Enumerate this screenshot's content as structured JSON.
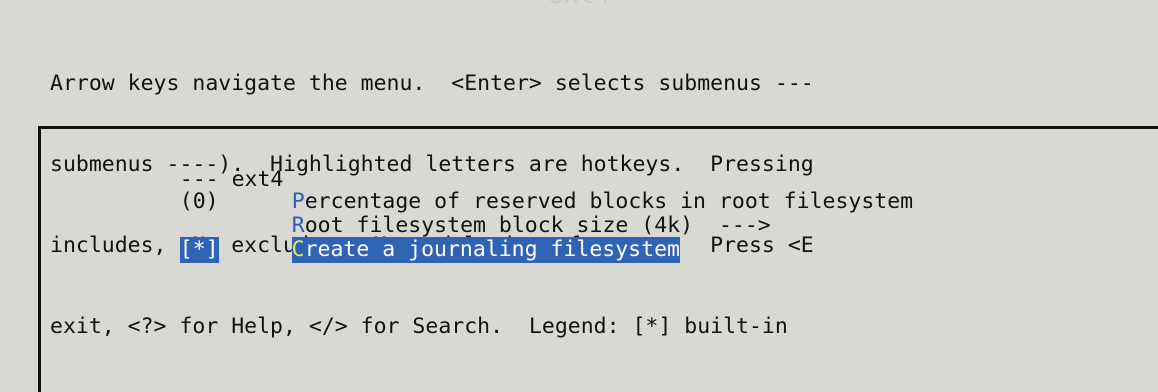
{
  "title_fragment": "ext4",
  "help_lines": [
    "Arrow keys navigate the menu.  <Enter> selects submenus ---",
    "submenus ----).  Highlighted letters are hotkeys.  Pressing",
    "includes, <N> excludes, <M> modularizes features.  Press <E",
    "exit, <?> for Help, </> for Search.  Legend: [*] built-in"
  ],
  "menu": {
    "items": [
      {
        "prefix": "--- ",
        "hotkey": "",
        "label": "ext4",
        "selected": false
      },
      {
        "prefix": "(0)",
        "hotkey": "P",
        "label": "ercentage of reserved blocks in root filesystem",
        "selected": false
      },
      {
        "prefix": "",
        "hotkey": "R",
        "label": "oot filesystem block size (4k)  --->",
        "selected": false
      },
      {
        "prefix": "[*]",
        "hotkey": "C",
        "label": "reate a journaling filesystem",
        "selected": true
      }
    ]
  },
  "colors": {
    "background": "#d9d9d4",
    "highlight": "#2f63b4",
    "hotkey": "#2e5eb8",
    "selected_hotkey": "#f2e54a"
  }
}
